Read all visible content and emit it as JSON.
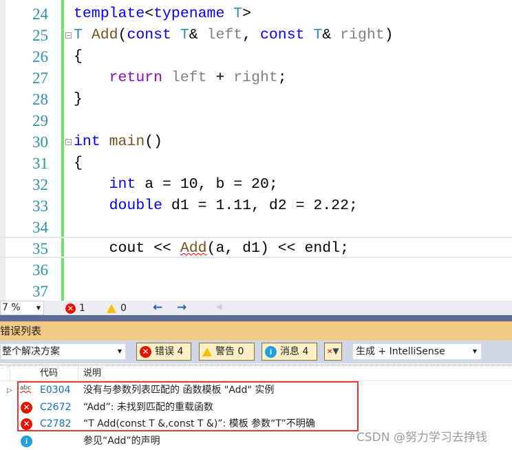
{
  "editor": {
    "lines": [
      {
        "n": "24",
        "tokens": [
          {
            "t": "template",
            "c": "#0000ff"
          },
          {
            "t": "<",
            "c": "#000"
          },
          {
            "t": "typename",
            "c": "#0000ff"
          },
          {
            "t": " ",
            "c": "#000"
          },
          {
            "t": "T",
            "c": "#2b91af"
          },
          {
            "t": ">",
            "c": "#000"
          }
        ]
      },
      {
        "n": "25",
        "fold": true,
        "tokens": [
          {
            "t": "T",
            "c": "#2b91af"
          },
          {
            "t": " ",
            "c": "#000"
          },
          {
            "t": "Add",
            "c": "#74531f"
          },
          {
            "t": "(",
            "c": "#000"
          },
          {
            "t": "const",
            "c": "#0000ff"
          },
          {
            "t": " ",
            "c": "#000"
          },
          {
            "t": "T",
            "c": "#2b91af"
          },
          {
            "t": "& ",
            "c": "#000"
          },
          {
            "t": "left",
            "c": "#808080"
          },
          {
            "t": ", ",
            "c": "#000"
          },
          {
            "t": "const",
            "c": "#0000ff"
          },
          {
            "t": " ",
            "c": "#000"
          },
          {
            "t": "T",
            "c": "#2b91af"
          },
          {
            "t": "& ",
            "c": "#000"
          },
          {
            "t": "right",
            "c": "#808080"
          },
          {
            "t": ")",
            "c": "#000"
          }
        ]
      },
      {
        "n": "26",
        "tokens": [
          {
            "t": "{",
            "c": "#000"
          }
        ]
      },
      {
        "n": "27",
        "tokens": [
          {
            "t": "    ",
            "c": "#000"
          },
          {
            "t": "return",
            "c": "#8f08c4"
          },
          {
            "t": " ",
            "c": "#000"
          },
          {
            "t": "left",
            "c": "#808080"
          },
          {
            "t": " + ",
            "c": "#000"
          },
          {
            "t": "right",
            "c": "#808080"
          },
          {
            "t": ";",
            "c": "#000"
          }
        ]
      },
      {
        "n": "28",
        "tokens": [
          {
            "t": "}",
            "c": "#000"
          }
        ]
      },
      {
        "n": "29",
        "tokens": []
      },
      {
        "n": "30",
        "fold": true,
        "tokens": [
          {
            "t": "int",
            "c": "#0000ff"
          },
          {
            "t": " ",
            "c": "#000"
          },
          {
            "t": "main",
            "c": "#74531f"
          },
          {
            "t": "()",
            "c": "#000"
          }
        ]
      },
      {
        "n": "31",
        "tokens": [
          {
            "t": "{",
            "c": "#000"
          }
        ]
      },
      {
        "n": "32",
        "tokens": [
          {
            "t": "    ",
            "c": "#000"
          },
          {
            "t": "int",
            "c": "#0000ff"
          },
          {
            "t": " a = 10, b = 20;",
            "c": "#000"
          }
        ]
      },
      {
        "n": "33",
        "tokens": [
          {
            "t": "    ",
            "c": "#000"
          },
          {
            "t": "double",
            "c": "#0000ff"
          },
          {
            "t": " d1 = 1.11, d2 = 2.22;",
            "c": "#000"
          }
        ]
      },
      {
        "n": "34",
        "tokens": []
      },
      {
        "n": "35",
        "current": true,
        "tokens": [
          {
            "t": "    cout << ",
            "c": "#000"
          },
          {
            "t": "Add",
            "c": "#74531f",
            "squiggle": true
          },
          {
            "t": "(a, d1) << endl;",
            "c": "#000"
          }
        ]
      },
      {
        "n": "36",
        "tokens": []
      },
      {
        "n": "37",
        "tokens": []
      }
    ]
  },
  "statusbar": {
    "zoom": "7 %",
    "errors": "1",
    "warnings": "0"
  },
  "panel": {
    "title": "错误列表"
  },
  "filters": {
    "scope": "整个解决方案",
    "errors": "错误 4",
    "warnings": "警告 0",
    "messages": "消息 4",
    "source": "生成 + IntelliSense"
  },
  "columns": {
    "code": "代码",
    "desc": "说明"
  },
  "rows": [
    {
      "icon": "intellisense-icon",
      "code": "E0304",
      "desc": "没有与参数列表匹配的 函数模板 \"Add\" 实例"
    },
    {
      "icon": "error-icon",
      "code": "C2672",
      "desc": "“Add”: 未找到匹配的重载函数"
    },
    {
      "icon": "error-icon",
      "code": "C2782",
      "desc": "“T Add(const T &,const T &)”: 模板 参数“T”不明确"
    },
    {
      "icon": "info-icon",
      "code": "",
      "desc": "参见“Add”的声明"
    }
  ],
  "watermark": "CSDN @努力学习去挣钱",
  "colors": {
    "error": "#e51400",
    "warning": "#f8c100",
    "info": "#1ba1e2",
    "highlight": "#e83535"
  }
}
